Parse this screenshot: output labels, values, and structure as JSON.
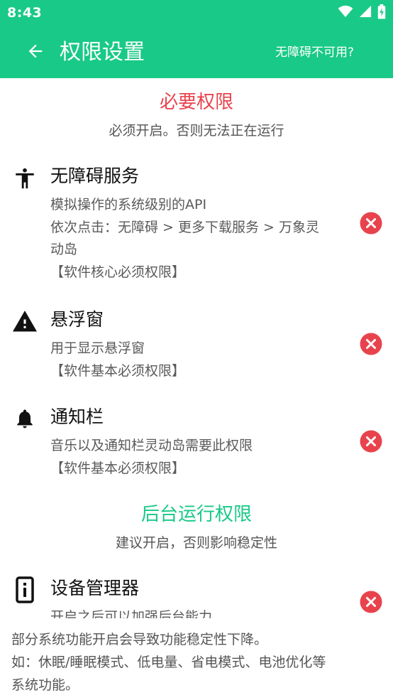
{
  "status_bar": {
    "time": "8:43",
    "icons": [
      "wifi-icon",
      "signal-icon",
      "battery-charging-icon"
    ]
  },
  "app_bar": {
    "back_icon": "arrow-left-icon",
    "title": "权限设置",
    "action_label": "无障碍不可用?"
  },
  "sections": {
    "required": {
      "title": "必要权限",
      "subtitle": "必须开启。否则无法正在运行",
      "color": "#e8434d"
    },
    "background": {
      "title": "后台运行权限",
      "subtitle": "建议开启，否则影响稳定性",
      "color": "#19c987"
    }
  },
  "permissions": [
    {
      "icon": "accessibility-icon",
      "title": "无障碍服务",
      "desc": [
        "模拟操作的系统级别的API",
        "依次点击：无障碍 > 更多下载服务 > 万象灵",
        "动岛",
        "【软件核心必须权限】"
      ],
      "status": "close-circle-icon"
    },
    {
      "icon": "warning-icon",
      "title": "悬浮窗",
      "desc": [
        "用于显示悬浮窗",
        "【软件基本必须权限】"
      ],
      "status": "close-circle-icon"
    },
    {
      "icon": "bell-icon",
      "title": "通知栏",
      "desc": [
        "音乐以及通知栏灵动岛需要此权限",
        "【软件基本必须权限】"
      ],
      "status": "close-circle-icon"
    },
    {
      "icon": "device-info-icon",
      "title": "设备管理器",
      "desc": [
        "开启之后可以加强后台能力"
      ],
      "status": "close-circle-icon"
    }
  ],
  "footer": {
    "lines": [
      "部分系统功能开启会导致功能稳定性下降。",
      "如：休眠/睡眠模式、低电量、省电模式、电池优化等",
      "系统功能。"
    ]
  },
  "colors": {
    "accent": "#19c987",
    "error": "#e8434d"
  }
}
